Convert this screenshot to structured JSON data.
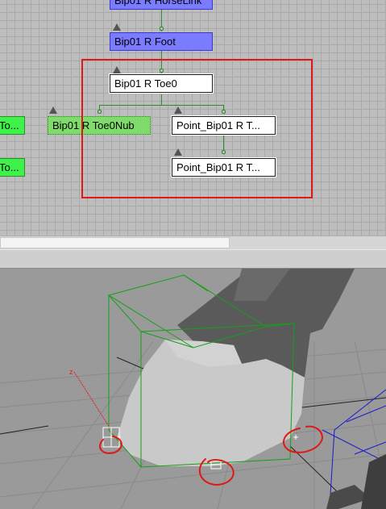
{
  "schematic": {
    "nodes": {
      "horselink": "Bip01 R HorseLink",
      "foot": "Bip01 R Foot",
      "toe0": "Bip01 R Toe0",
      "toe0nub": "Bip01 R Toe0Nub",
      "point1": "Point_Bip01 R T...",
      "point2": "Point_Bip01 R T...",
      "left_green_1": "To...",
      "left_green_2": "To..."
    },
    "colors": {
      "biped_node": "#7b7bff",
      "selected_node": "#ffffff",
      "nub_node": "#7fdc6c",
      "wire": "#2e8b2e",
      "annotation": "#e01818"
    }
  },
  "viewport": {
    "axis_label": "z",
    "colors": {
      "bounding_box": "#16a016",
      "annotation": "#e01818",
      "axis": "#e02020",
      "grid_helper": "#1a1ad0"
    }
  }
}
